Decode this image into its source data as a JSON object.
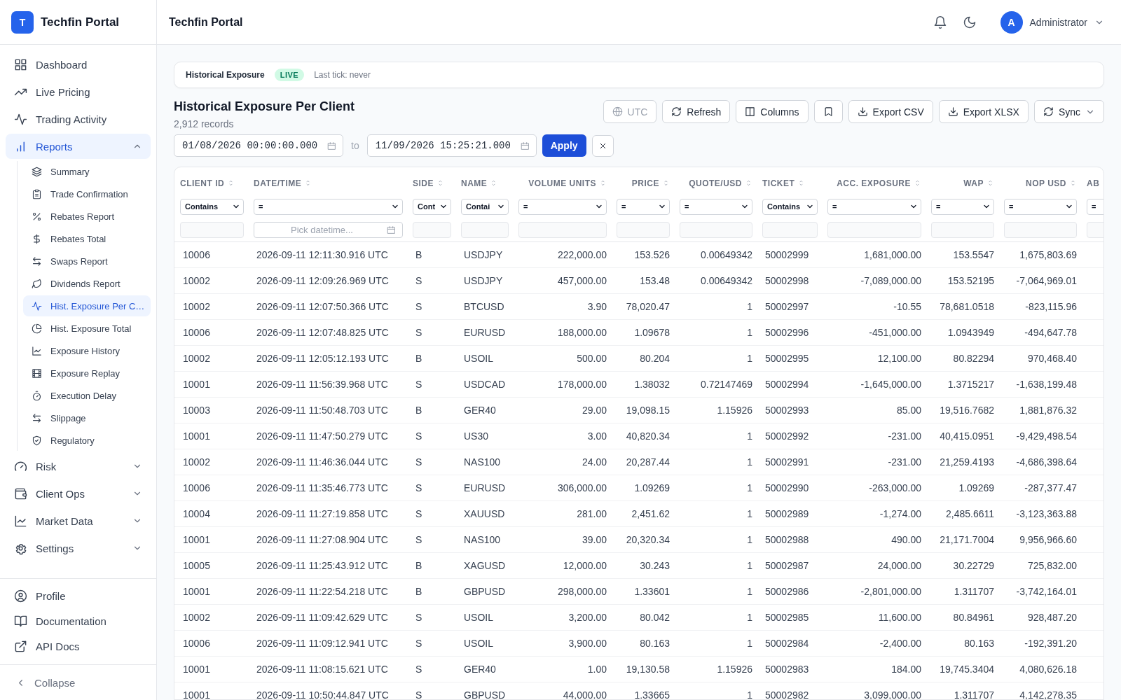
{
  "sidebar": {
    "logo_letter": "T",
    "app_name": "Techfin Portal",
    "items": [
      {
        "label": "Dashboard",
        "selected": false
      },
      {
        "label": "Live Pricing",
        "selected": false
      },
      {
        "label": "Trading Activity",
        "selected": false
      },
      {
        "label": "Reports",
        "selected": true,
        "expanded": true,
        "children": [
          {
            "label": "Summary",
            "selected": false
          },
          {
            "label": "Trade Confirmation",
            "selected": false
          },
          {
            "label": "Rebates Report",
            "selected": false
          },
          {
            "label": "Rebates Total",
            "selected": false
          },
          {
            "label": "Swaps Report",
            "selected": false
          },
          {
            "label": "Dividends Report",
            "selected": false
          },
          {
            "label": "Hist. Exposure Per C…",
            "selected": true
          },
          {
            "label": "Hist. Exposure Total",
            "selected": false
          },
          {
            "label": "Exposure History",
            "selected": false
          },
          {
            "label": "Exposure Replay",
            "selected": false
          },
          {
            "label": "Execution Delay",
            "selected": false
          },
          {
            "label": "Slippage",
            "selected": false
          },
          {
            "label": "Regulatory",
            "selected": false
          }
        ]
      },
      {
        "label": "Risk",
        "selected": false,
        "expanded": false
      },
      {
        "label": "Client Ops",
        "selected": false,
        "expanded": false
      },
      {
        "label": "Market Data",
        "selected": false,
        "expanded": false
      },
      {
        "label": "Settings",
        "selected": false,
        "expanded": false
      }
    ],
    "footer_links": [
      "Profile",
      "Documentation",
      "API Docs"
    ],
    "collapse": "Collapse"
  },
  "header": {
    "title": "Techfin Portal",
    "avatar_letter": "A",
    "user": "Administrator"
  },
  "status_bar": {
    "label": "Historical Exposure",
    "badge": "LIVE",
    "last_tick": "Last tick: never"
  },
  "page": {
    "title": "Historical Exposure Per Client",
    "count": "2,912 records"
  },
  "toolbar": [
    {
      "label": "UTC",
      "disabled": true
    },
    {
      "label": "Refresh",
      "disabled": false
    },
    {
      "label": "Columns",
      "disabled": false
    },
    {
      "disabled": false
    },
    {
      "label": "Export CSV",
      "disabled": false
    },
    {
      "label": "Export XLSX",
      "disabled": false
    },
    {
      "label": "Sync",
      "disabled": false
    }
  ],
  "date_range": {
    "from": "01/08/2026 00:00:00.000",
    "separator": "to",
    "to": "11/09/2026 15:25:21.000",
    "apply": "Apply"
  },
  "table": {
    "columns": [
      {
        "label": "CLIENT ID",
        "kind": "text",
        "operator": "Contains"
      },
      {
        "label": "DATE/TIME",
        "kind": "text",
        "operator": "=",
        "placeholder": "Pick datetime..."
      },
      {
        "label": "SIDE",
        "kind": "text",
        "operator": "Cont"
      },
      {
        "label": "NAME",
        "kind": "text",
        "operator": "Contai"
      },
      {
        "label": "VOLUME UNITS",
        "kind": "number",
        "operator": "="
      },
      {
        "label": "PRICE",
        "kind": "number",
        "operator": "="
      },
      {
        "label": "QUOTE/USD",
        "kind": "number",
        "operator": "="
      },
      {
        "label": "TICKET",
        "kind": "text",
        "operator": "Contains"
      },
      {
        "label": "ACC. EXPOSURE",
        "kind": "number",
        "operator": "="
      },
      {
        "label": "WAP",
        "kind": "number",
        "operator": "="
      },
      {
        "label": "NOP USD",
        "kind": "number",
        "operator": "="
      },
      {
        "label": "AB",
        "kind": "text",
        "operator": "="
      }
    ],
    "rows": [
      [
        "10006",
        "2026-09-11 12:11:30.916 UTC",
        "B",
        "USDJPY",
        "222,000.00",
        "153.526",
        "0.00649342",
        "50002999",
        "1,681,000.00",
        "153.5547",
        "1,675,803.69"
      ],
      [
        "10002",
        "2026-09-11 12:09:26.969 UTC",
        "S",
        "USDJPY",
        "457,000.00",
        "153.48",
        "0.00649342",
        "50002998",
        "-7,089,000.00",
        "153.52195",
        "-7,064,969.01"
      ],
      [
        "10002",
        "2026-09-11 12:07:50.366 UTC",
        "S",
        "BTCUSD",
        "3.90",
        "78,020.47",
        "1",
        "50002997",
        "-10.55",
        "78,681.0518",
        "-823,115.96"
      ],
      [
        "10006",
        "2026-09-11 12:07:48.825 UTC",
        "S",
        "EURUSD",
        "188,000.00",
        "1.09678",
        "1",
        "50002996",
        "-451,000.00",
        "1.0943949",
        "-494,647.78"
      ],
      [
        "10002",
        "2026-09-11 12:05:12.193 UTC",
        "B",
        "USOIL",
        "500.00",
        "80.204",
        "1",
        "50002995",
        "12,100.00",
        "80.82294",
        "970,468.40"
      ],
      [
        "10001",
        "2026-09-11 11:56:39.968 UTC",
        "S",
        "USDCAD",
        "178,000.00",
        "1.38032",
        "0.72147469",
        "50002994",
        "-1,645,000.00",
        "1.3715217",
        "-1,638,199.48"
      ],
      [
        "10003",
        "2026-09-11 11:50:48.703 UTC",
        "B",
        "GER40",
        "29.00",
        "19,098.15",
        "1.15926",
        "50002993",
        "85.00",
        "19,516.7682",
        "1,881,876.32"
      ],
      [
        "10001",
        "2026-09-11 11:47:50.279 UTC",
        "S",
        "US30",
        "3.00",
        "40,820.34",
        "1",
        "50002992",
        "-231.00",
        "40,415.0951",
        "-9,429,498.54"
      ],
      [
        "10002",
        "2026-09-11 11:46:36.044 UTC",
        "S",
        "NAS100",
        "24.00",
        "20,287.44",
        "1",
        "50002991",
        "-231.00",
        "21,259.4193",
        "-4,686,398.64"
      ],
      [
        "10006",
        "2026-09-11 11:35:46.773 UTC",
        "S",
        "EURUSD",
        "306,000.00",
        "1.09269",
        "1",
        "50002990",
        "-263,000.00",
        "1.09269",
        "-287,377.47"
      ],
      [
        "10004",
        "2026-09-11 11:27:19.858 UTC",
        "S",
        "XAUUSD",
        "281.00",
        "2,451.62",
        "1",
        "50002989",
        "-1,274.00",
        "2,485.6611",
        "-3,123,363.88"
      ],
      [
        "10001",
        "2026-09-11 11:27:08.904 UTC",
        "S",
        "NAS100",
        "39.00",
        "20,320.34",
        "1",
        "50002988",
        "490.00",
        "21,171.7004",
        "9,956,966.60"
      ],
      [
        "10005",
        "2026-09-11 11:25:43.912 UTC",
        "B",
        "XAGUSD",
        "12,000.00",
        "30.243",
        "1",
        "50002987",
        "24,000.00",
        "30.22729",
        "725,832.00"
      ],
      [
        "10001",
        "2026-09-11 11:22:54.218 UTC",
        "B",
        "GBPUSD",
        "298,000.00",
        "1.33601",
        "1",
        "50002986",
        "-2,801,000.00",
        "1.311707",
        "-3,742,164.01"
      ],
      [
        "10002",
        "2026-09-11 11:09:42.629 UTC",
        "S",
        "USOIL",
        "3,200.00",
        "80.042",
        "1",
        "50002985",
        "11,600.00",
        "80.84961",
        "928,487.20"
      ],
      [
        "10006",
        "2026-09-11 11:09:12.941 UTC",
        "S",
        "USOIL",
        "3,900.00",
        "80.163",
        "1",
        "50002984",
        "-2,400.00",
        "80.163",
        "-192,391.20"
      ],
      [
        "10001",
        "2026-09-11 11:08:15.621 UTC",
        "S",
        "GER40",
        "1.00",
        "19,130.58",
        "1.15926",
        "50002983",
        "184.00",
        "19,745.3404",
        "4,080,626.18"
      ],
      [
        "10001",
        "2026-09-11 10:50:44.847 UTC",
        "S",
        "GBPUSD",
        "44,000.00",
        "1.33665",
        "1",
        "50002982",
        "3,099,000.00",
        "1.311707",
        "4,142,278.35"
      ]
    ]
  }
}
